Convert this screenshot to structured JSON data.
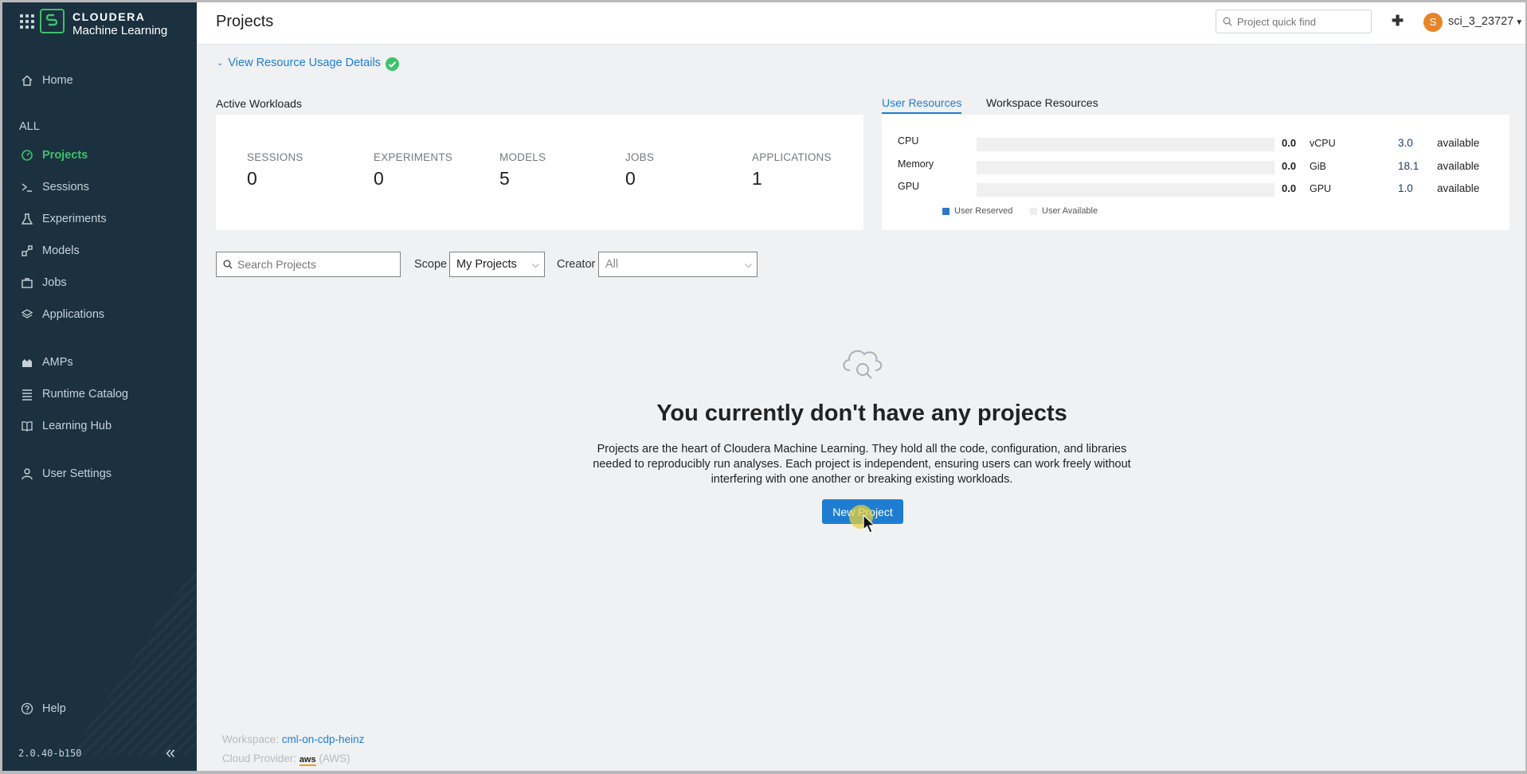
{
  "sidebar": {
    "logo": {
      "line1": "CLOUDERA",
      "line2": "Machine Learning"
    },
    "items_top": [
      {
        "label": "Home",
        "icon": "home-icon"
      }
    ],
    "section_label": "ALL",
    "items_all": [
      {
        "label": "Projects",
        "icon": "gauge-icon",
        "active": true
      },
      {
        "label": "Sessions",
        "icon": "terminal-icon"
      },
      {
        "label": "Experiments",
        "icon": "flask-icon"
      },
      {
        "label": "Models",
        "icon": "models-icon"
      },
      {
        "label": "Jobs",
        "icon": "briefcase-icon"
      },
      {
        "label": "Applications",
        "icon": "layers-icon"
      }
    ],
    "items_more": [
      {
        "label": "AMPs",
        "icon": "amps-icon"
      },
      {
        "label": "Runtime Catalog",
        "icon": "list-icon"
      },
      {
        "label": "Learning Hub",
        "icon": "book-icon"
      }
    ],
    "user_settings": {
      "label": "User Settings",
      "icon": "user-icon"
    },
    "help": {
      "label": "Help",
      "icon": "help-icon"
    },
    "version": "2.0.40-b150"
  },
  "header": {
    "title": "Projects",
    "quickfind_placeholder": "Project quick find",
    "avatar_initial": "S",
    "username": "sci_3_23727"
  },
  "usage": {
    "link_label": "View Resource Usage Details",
    "active_workloads_label": "Active Workloads",
    "stats": [
      {
        "label": "SESSIONS",
        "value": "0"
      },
      {
        "label": "EXPERIMENTS",
        "value": "0"
      },
      {
        "label": "MODELS",
        "value": "5"
      },
      {
        "label": "JOBS",
        "value": "0"
      },
      {
        "label": "APPLICATIONS",
        "value": "1"
      }
    ]
  },
  "resources": {
    "tabs": [
      {
        "label": "User Resources",
        "active": true
      },
      {
        "label": "Workspace Resources"
      }
    ],
    "rows": [
      {
        "name": "CPU",
        "used": "0.0",
        "unit": "vCPU",
        "available": "3.0",
        "available_label": "available",
        "fraction": 0
      },
      {
        "name": "Memory",
        "used": "0.0",
        "unit": "GiB",
        "available": "18.1",
        "available_label": "available",
        "fraction": 0
      },
      {
        "name": "GPU",
        "used": "0.0",
        "unit": "GPU",
        "available": "1.0",
        "available_label": "available",
        "fraction": 0
      }
    ],
    "legend": {
      "reserved": "User Reserved",
      "available": "User Available"
    },
    "colors": {
      "reserved": "#2f76c8",
      "available": "#eeeeee"
    }
  },
  "filters": {
    "search_placeholder": "Search Projects",
    "scope_label": "Scope",
    "scope_value": "My Projects",
    "creator_label": "Creator",
    "creator_value": "All"
  },
  "empty_state": {
    "title": "You currently don't have any projects",
    "description": "Projects are the heart of Cloudera Machine Learning. They hold all the code, configuration, and libraries needed to reproducibly run analyses. Each project is independent, ensuring users can work freely without interfering with one another or breaking existing workloads.",
    "button_label": "New Project"
  },
  "footer": {
    "workspace_label": "Workspace:",
    "workspace_value": "cml-on-cdp-heinz",
    "provider_label": "Cloud Provider:",
    "provider_logo": "aws",
    "provider_value": "(AWS)"
  },
  "theme": {
    "accent": "#1f7dd1",
    "sidebar_bg": "#1b3140",
    "active_green": "#3ec26a"
  }
}
